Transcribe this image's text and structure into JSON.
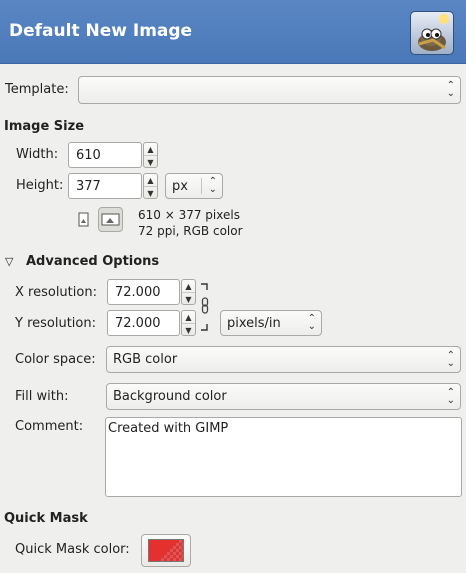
{
  "header": {
    "title": "Default New Image"
  },
  "template": {
    "label": "Template:",
    "value": ""
  },
  "image_size": {
    "section_title": "Image Size",
    "width_label": "Width:",
    "width_value": "610",
    "height_label": "Height:",
    "height_value": "377",
    "unit": "px",
    "info_pixels": "610 × 377 pixels",
    "info_ppi": "72 ppi, RGB color"
  },
  "advanced": {
    "section_title": "Advanced Options",
    "xres_label": "X resolution:",
    "xres_value": "72.000",
    "yres_label": "Y resolution:",
    "yres_value": "72.000",
    "res_unit": "pixels/in",
    "color_space_label": "Color space:",
    "color_space_value": "RGB color",
    "fill_label": "Fill with:",
    "fill_value": "Background color",
    "comment_label": "Comment:",
    "comment_value": "Created with GIMP"
  },
  "quick_mask": {
    "section_title": "Quick Mask",
    "color_label": "Quick Mask color:",
    "color": "#e53030"
  },
  "colors": {
    "header_bg": "#4a78b8",
    "window_bg": "#efefed"
  }
}
